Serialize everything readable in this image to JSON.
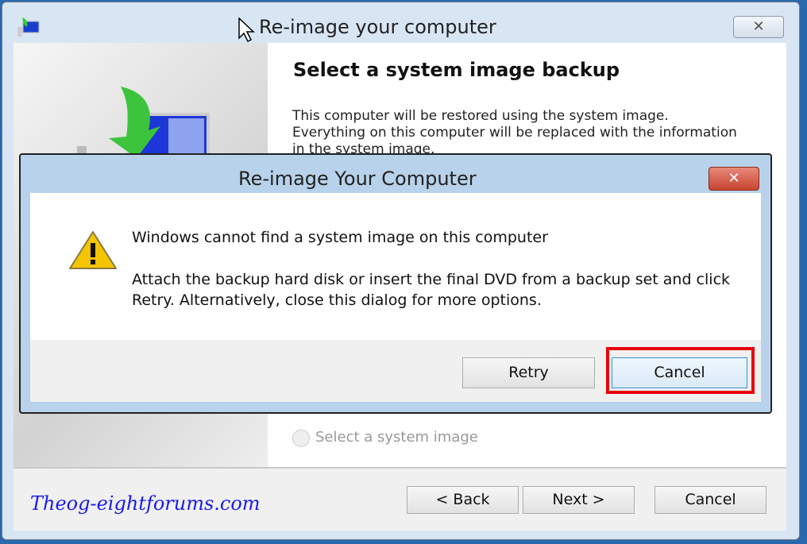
{
  "window": {
    "title": "Re-image your computer",
    "close_icon": "close-icon"
  },
  "wizard": {
    "heading": "Select a system image backup",
    "description": "This computer will be restored using the system image. Everything on this computer will be replaced with the information in the system image.",
    "radio_label": "Select a system image",
    "back_label": "< Back",
    "next_label": "Next >",
    "cancel_label": "Cancel"
  },
  "dialog": {
    "title": "Re-image Your Computer",
    "close_label": "✕",
    "message": "Windows cannot find a system image on this computer",
    "detail": "Attach the backup hard disk or insert the final DVD from a backup set and click Retry. Alternatively, close this dialog for more options.",
    "retry_label": "Retry",
    "cancel_label": "Cancel",
    "icon": "warning-icon"
  },
  "watermark": "Theog-eightforums.com",
  "colors": {
    "highlight": "#e8000b",
    "desktop": "#2a68ad"
  }
}
